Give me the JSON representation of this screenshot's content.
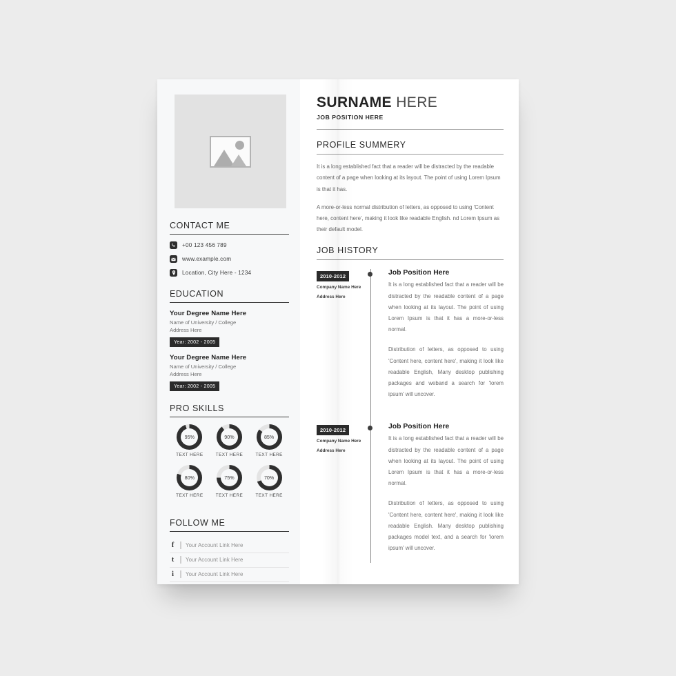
{
  "theme": {
    "page_bg": "#ececec",
    "sheet_bg": "#ffffff",
    "sidebar_bg": "#f7f8f9",
    "accent_dark": "#2b2b2b",
    "muted_text": "#6b6b6b"
  },
  "sidebar": {
    "photo": {
      "icon": "image-placeholder-icon"
    },
    "contact": {
      "title": "CONTACT ME",
      "items": [
        {
          "icon": "phone-icon",
          "text": "+00 123 456 789"
        },
        {
          "icon": "email-icon",
          "text": "www.example.com"
        },
        {
          "icon": "location-pin-icon",
          "text": "Location, City Here - 1234"
        }
      ]
    },
    "education": {
      "title": "EDUCATION",
      "items": [
        {
          "degree": "Your Degree Name Here",
          "university": "Name of University / College",
          "address": "Address Here",
          "year": "Year: 2002 - 2005"
        },
        {
          "degree": "Your Degree Name Here",
          "university": "Name of University / College",
          "address": "Address Here",
          "year": "Year: 2002 - 2005"
        }
      ]
    },
    "skills": {
      "title": "PRO SKILLS",
      "items": [
        {
          "value": 95,
          "label": "95%",
          "caption": "TEXT HERE"
        },
        {
          "value": 90,
          "label": "90%",
          "caption": "TEXT HERE"
        },
        {
          "value": 85,
          "label": "85%",
          "caption": "TEXT HERE"
        },
        {
          "value": 80,
          "label": "80%",
          "caption": "TEXT HERE"
        },
        {
          "value": 75,
          "label": "75%",
          "caption": "TEXT HERE"
        },
        {
          "value": 70,
          "label": "70%",
          "caption": "TEXT HERE"
        }
      ]
    },
    "follow": {
      "title": "FOLLOW ME",
      "items": [
        {
          "icon": "facebook-icon",
          "glyph": "f",
          "text": "Your Account Link Here"
        },
        {
          "icon": "twitter-icon",
          "glyph": "t",
          "text": "Your Account Link Here"
        },
        {
          "icon": "instagram-icon",
          "glyph": "i",
          "text": "Your Account Link Here"
        }
      ]
    }
  },
  "main": {
    "name_bold": "SURNAME",
    "name_light": "HERE",
    "job_position": "JOB POSITION HERE",
    "profile": {
      "title": "PROFILE SUMMERY",
      "paragraphs": [
        "It is a long established fact that a reader will be distracted by the readable content of a page when looking at its layout. The point of using Lorem Ipsum is that it has.",
        "A more-or-less normal distribution of letters, as opposed to using 'Content here, content here', making it look like readable English. nd Lorem Ipsum as their default model."
      ]
    },
    "job_history": {
      "title": "JOB HISTORY",
      "entries": [
        {
          "date": "2010-2012",
          "company": "Company Name Here",
          "address": "Address Here",
          "position": "Job Position Here",
          "paragraph1": "It is a long established fact that a reader will be distracted by the readable content of a page when looking at its layout. The point of using Lorem Ipsum is that it has a more-or-less normal.",
          "paragraph2": "Distribution of letters, as opposed to using 'Content here, content here', making it look like readable English, Many desktop publishing packages and weband a search for 'lorem ipsum' will uncover."
        },
        {
          "date": "2010-2012",
          "company": "Company Name Here",
          "address": "Address Here",
          "position": "Job Position Here",
          "paragraph1": "It is a long established fact that a reader will be distracted by the readable content of a page when looking at its layout. The point of using Lorem Ipsum is that it has a more-or-less normal.",
          "paragraph2": "Distribution of letters, as opposed to using 'Content here, content here', making it look like readable English. Many desktop publishing packages model text, and a search for 'lorem ipsum' will uncover."
        }
      ]
    }
  }
}
